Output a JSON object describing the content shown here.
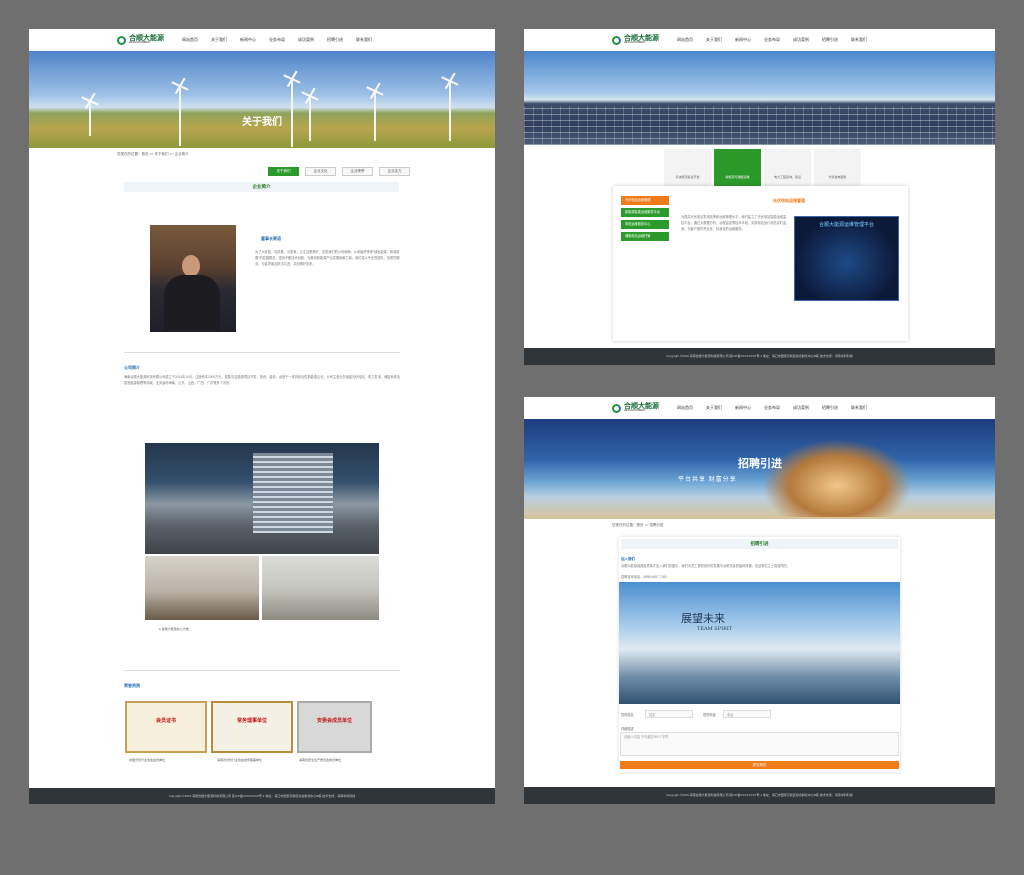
{
  "site": {
    "logo": "合顺大能源",
    "logo_sub": "HESHUN ENERGY",
    "menu": [
      "网站首页",
      "关于我们",
      "新闻中心",
      "业务布局",
      "成功案例",
      "招聘引进",
      "联系我们"
    ],
    "footer": "Copyright ©2019 海南合顺大能源科技有限公司  琼ICP备XXXXXXXX号-1  地址：海口市国家高新区综合孵化中心B栋 技术支持：海南中科科技"
  },
  "page1": {
    "banner_title": "关于我们",
    "breadcrumb": "您现在的位置：首页 >> 关于我们 >> 企业简介",
    "tabs": [
      "关于我们",
      "企业文化",
      "企业荣誉",
      "企业实力"
    ],
    "section1": "企业简介",
    "chairman_title": "董事长寄语",
    "chairman_text": "为了大家庭、向前推、示夏莱，让生活更美好，这是我们的公司使命。公司始终秉承\"绿色能源，和谐发展\"的发展理念，坚持不断技术创新，为推动新能源产业发展贡献力量。我们将以专业的团队、优质的服务，与各界朋友携手共进，共创美好未来。",
    "profile_title": "公司简介",
    "profile_text": "海南合顺大能源科技有限公司成立于2014年10月，注册资本2000万元，是集清洁能源项目开发、投资、建设、运营于一体的综合性新能源企业。公司主营业务涵盖光伏电站、风力发电、储能系统及智慧能源管理等领域，业务遍布海南、山东、山西、广西、广东等多个省份。",
    "photo_caption": "合顺大能源办公大楼",
    "honor_title": "荣誉资质",
    "certs": [
      {
        "title": "会员证书",
        "caption": "中国光伏行业协会会员单位"
      },
      {
        "title": "常务理事单位",
        "caption": "海南省光伏行业协会常务理事单位"
      },
      {
        "title": "安委会成员单位",
        "caption": "海南省安全生产委员会成员单位"
      }
    ]
  },
  "page2": {
    "services": [
      "清洁能源投资开发",
      "新能源与储能运维",
      "电力工程咨询、建设",
      "光伏发电服务"
    ],
    "active_service": "新能源与储能运维",
    "side_buttons": [
      "光伏电站运维管理",
      "新能源智能运维服务平台",
      "风电运维服务中心",
      "储能电站运维托管"
    ],
    "section_title": "光伏电站运维管理",
    "text": "为提高光伏电站发电效率和运维管理水平，我们建立了光伏电站智能运维监控平台，通过大数据分析、远程监控等技术手段，实现电站运行状态实时监测，为客户提供专业化、标准化的运维服务。",
    "dashboard_title": "合顺大能源运维管理平台"
  },
  "page3": {
    "banner_title": "招聘引进",
    "banner_slogan": "平台共享  财富分享",
    "breadcrumb": "您现在的位置：首页 >> 招聘引进",
    "section_title": "招聘引进",
    "intro_head": "加入我们",
    "intro_text": "合顺大能源诚邀各界英才加入我们的团队，我们为员工提供良好的发展平台和完善的福利待遇，欢迎有志之士投递简历。",
    "phone": "招聘咨询电话：0898-6657 7180",
    "team_title": "展望未来",
    "team_sub": "TEAM SPIRIT",
    "form": {
      "name_label": "您的姓名",
      "name_ph": "姓名",
      "phone_label": "您的电话",
      "phone_ph": "电话",
      "msg_label": "详细描述",
      "msg_ph": "请输入内容 不可超过500个字符",
      "submit": "提交简历"
    }
  }
}
